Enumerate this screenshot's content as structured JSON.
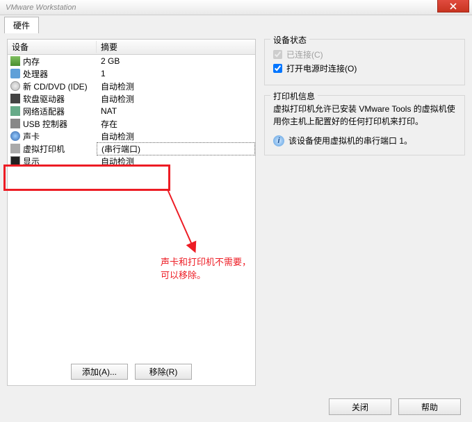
{
  "titlebar": {
    "title": "VMware Workstation"
  },
  "tab": {
    "label": "硬件"
  },
  "device_table": {
    "header_device": "设备",
    "header_summary": "摘要",
    "rows": [
      {
        "icon": "memory-icon",
        "iconcls": "ico-mem",
        "name": "内存",
        "summary": "2 GB",
        "selected": false
      },
      {
        "icon": "cpu-icon",
        "iconcls": "ico-cpu",
        "name": "处理器",
        "summary": "1",
        "selected": false
      },
      {
        "icon": "cd-icon",
        "iconcls": "ico-cd",
        "name": "新 CD/DVD (IDE)",
        "summary": "自动检测",
        "selected": false
      },
      {
        "icon": "floppy-icon",
        "iconcls": "ico-floppy",
        "name": "软盘驱动器",
        "summary": "自动检测",
        "selected": false
      },
      {
        "icon": "network-icon",
        "iconcls": "ico-net",
        "name": "网络适配器",
        "summary": "NAT",
        "selected": false
      },
      {
        "icon": "usb-icon",
        "iconcls": "ico-usb",
        "name": "USB 控制器",
        "summary": "存在",
        "selected": false
      },
      {
        "icon": "sound-icon",
        "iconcls": "ico-snd",
        "name": "声卡",
        "summary": "自动检测",
        "selected": false
      },
      {
        "icon": "printer-icon",
        "iconcls": "ico-prn",
        "name": "虚拟打印机",
        "summary": "(串行端口)",
        "selected": true
      },
      {
        "icon": "display-icon",
        "iconcls": "ico-disp",
        "name": "显示",
        "summary": "自动检测",
        "selected": false
      }
    ]
  },
  "buttons": {
    "add": "添加(A)...",
    "remove": "移除(R)"
  },
  "device_status": {
    "legend": "设备状态",
    "connected_label": "已连接(C)",
    "connected_checked": true,
    "connected_disabled": true,
    "poweron_label": "打开电源时连接(O)",
    "poweron_checked": true
  },
  "printer_info": {
    "legend": "打印机信息",
    "text": "虚拟打印机允许已安装 VMware Tools 的虚拟机使用你主机上配置好的任何打印机来打印。",
    "note": "该设备使用虚拟机的串行端口 1。"
  },
  "annotation": {
    "text": "声卡和打印机不需要，可以移除。"
  },
  "footer": {
    "close": "关闭",
    "help": "帮助"
  }
}
